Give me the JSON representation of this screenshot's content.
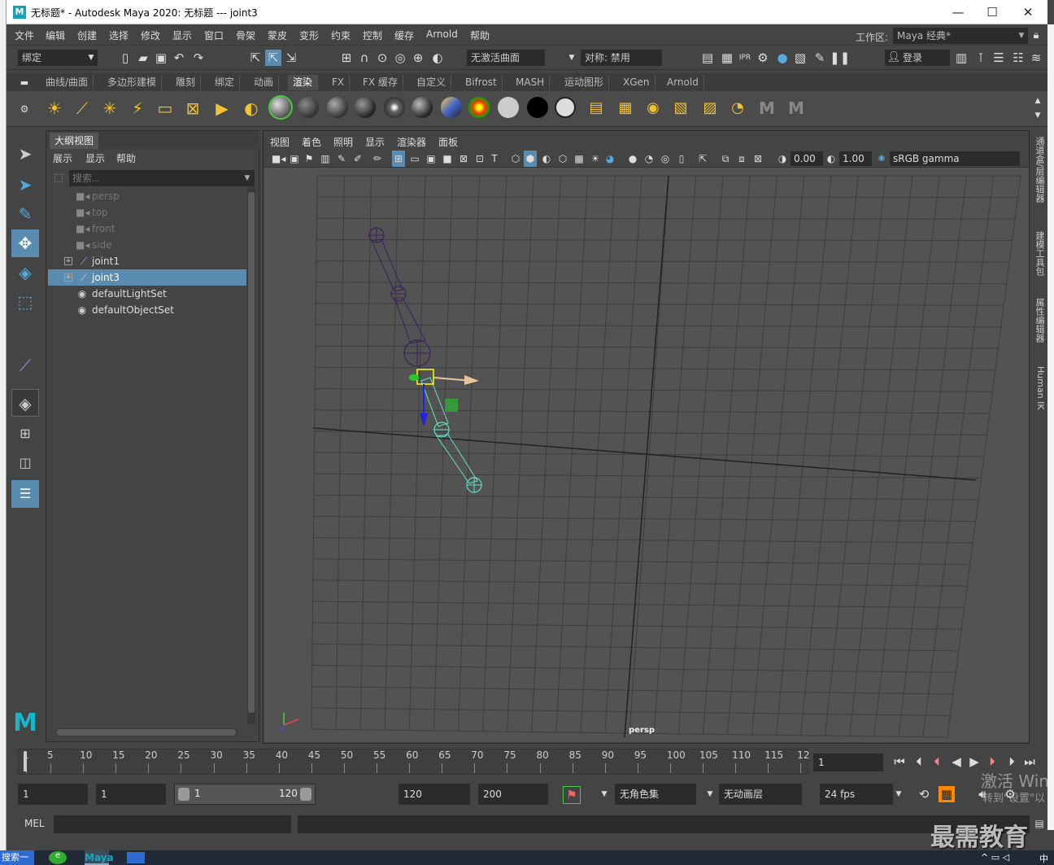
{
  "window": {
    "title": "无标题* - Autodesk Maya 2020: 无标题   ---   joint3",
    "logo": "M",
    "minimize": "—",
    "maximize": "☐",
    "close": "✕"
  },
  "menu": {
    "items": [
      "文件",
      "编辑",
      "创建",
      "选择",
      "修改",
      "显示",
      "窗口",
      "骨架",
      "蒙皮",
      "变形",
      "约束",
      "控制",
      "缓存",
      "Arnold",
      "帮助"
    ],
    "workspace_label": "工作区:",
    "workspace_value": "Maya 经典*"
  },
  "status": {
    "mode": "绑定",
    "surface": "无激活曲面",
    "symmetry": "对称: 禁用",
    "login": "登录"
  },
  "shelf": {
    "tabs": [
      "曲线/曲面",
      "多边形建模",
      "雕刻",
      "绑定",
      "动画",
      "渲染",
      "FX",
      "FX 缓存",
      "自定义",
      "Bifrost",
      "MASH",
      "运动图形",
      "XGen",
      "Arnold"
    ],
    "active_tab": "渲染"
  },
  "outliner": {
    "tab": "大纲视图",
    "menu": [
      "展示",
      "显示",
      "帮助"
    ],
    "search_placeholder": "搜索...",
    "items": [
      {
        "label": "persp",
        "type": "camera"
      },
      {
        "label": "top",
        "type": "camera"
      },
      {
        "label": "front",
        "type": "camera"
      },
      {
        "label": "side",
        "type": "camera"
      },
      {
        "label": "joint1",
        "type": "joint"
      },
      {
        "label": "joint3",
        "type": "joint"
      },
      {
        "label": "defaultLightSet",
        "type": "set"
      },
      {
        "label": "defaultObjectSet",
        "type": "set"
      }
    ],
    "selected": "joint3"
  },
  "viewport": {
    "menu": [
      "视图",
      "着色",
      "照明",
      "显示",
      "渲染器",
      "面板"
    ],
    "exposure": "0.00",
    "gamma": "1.00",
    "colorspace": "sRGB gamma",
    "camera_label": "persp"
  },
  "right_tabs": [
    "通道盒/层编辑器",
    "建模工具包",
    "属性编辑器",
    "Human IK"
  ],
  "timeline": {
    "ticks": [
      "1",
      "5",
      "10",
      "15",
      "20",
      "25",
      "30",
      "35",
      "40",
      "45",
      "50",
      "55",
      "60",
      "65",
      "70",
      "75",
      "80",
      "85",
      "90",
      "95",
      "100",
      "105",
      "110",
      "115",
      "12"
    ],
    "current_frame": "1"
  },
  "range": {
    "start": "1",
    "playback_start": "1",
    "slider_start": "1",
    "slider_end": "120",
    "playback_end": "120",
    "end": "200",
    "char_set": "无角色集",
    "anim_layer": "无动画层",
    "fps": "24 fps"
  },
  "cmd": {
    "label": "MEL"
  },
  "overlay": {
    "activate": "激活 Win",
    "goto_settings": "转到\"设置\"以",
    "watermark": "最需教育"
  },
  "taskbar": {
    "search": "搜索一下",
    "app": "Maya",
    "clock": "中"
  }
}
